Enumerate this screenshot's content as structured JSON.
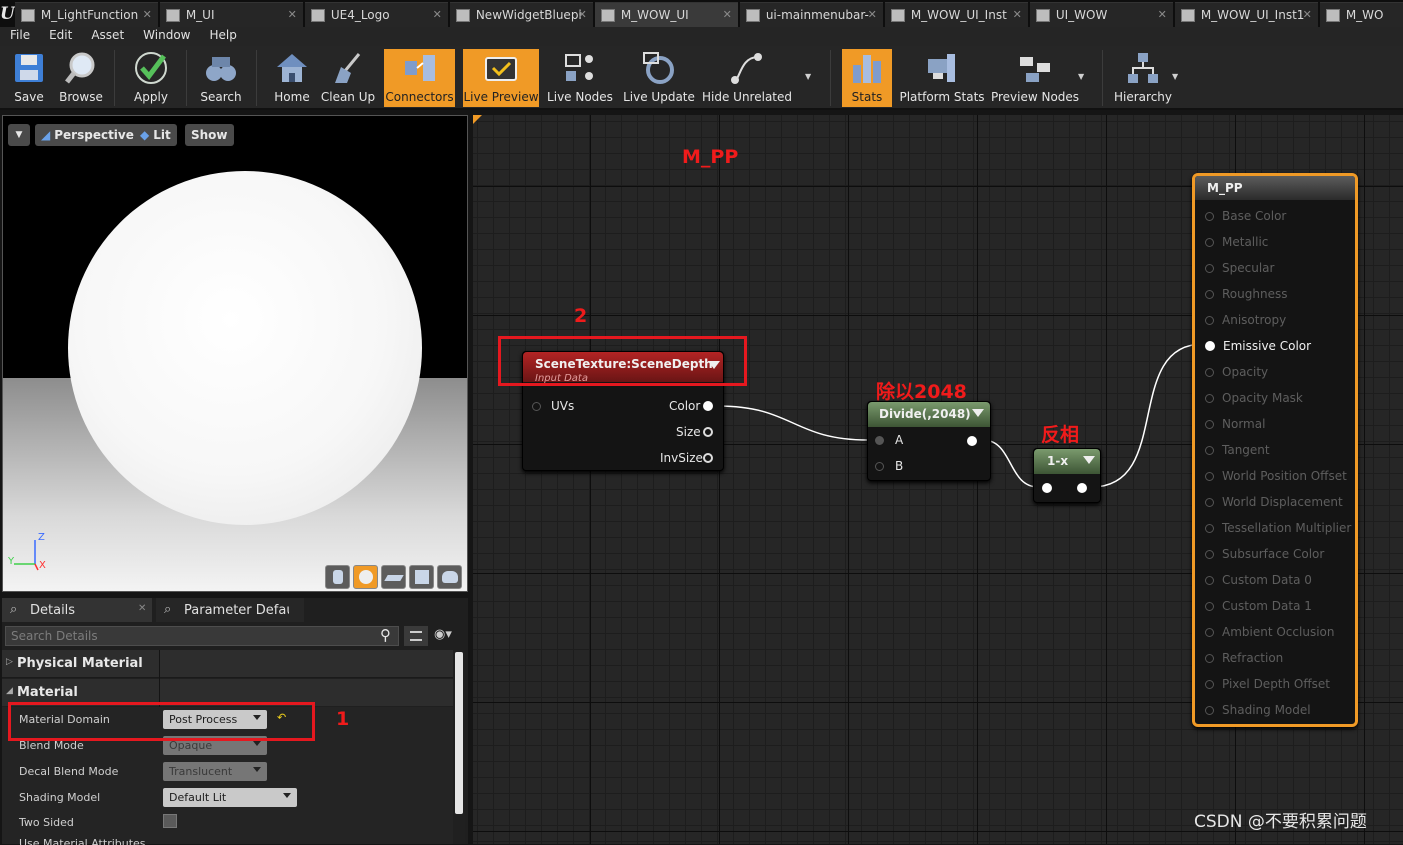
{
  "tabs": [
    "M_LightFunction",
    "M_UI",
    "UE4_Logo",
    "NewWidgetBluepi",
    "M_WOW_UI",
    "ui-mainmenubar-",
    "M_WOW_UI_Inst",
    "UI_WOW",
    "M_WOW_UI_Inst1",
    "M_WO"
  ],
  "menu": [
    "File",
    "Edit",
    "Asset",
    "Window",
    "Help"
  ],
  "toolbar": {
    "save": "Save",
    "browse": "Browse",
    "apply": "Apply",
    "search": "Search",
    "home": "Home",
    "cleanup": "Clean Up",
    "connectors": "Connectors",
    "livepreview": "Live Preview",
    "livenodes": "Live Nodes",
    "liveupdate": "Live Update",
    "hideunrelated": "Hide Unrelated",
    "stats": "Stats",
    "platformstats": "Platform Stats",
    "previewnodes": "Preview Nodes",
    "hierarchy": "Hierarchy"
  },
  "viewport": {
    "perspective": "Perspective",
    "lit": "Lit",
    "show": "Show",
    "axis_z": "Z",
    "axis_x": "X",
    "axis_y": "Y"
  },
  "details": {
    "tab1": "Details",
    "tab2": "Parameter Defaults",
    "search_placeholder": "Search Details",
    "cat_physical": "Physical Material",
    "cat_material": "Material",
    "rows": [
      {
        "label": "Material Domain",
        "value": "Post Process"
      },
      {
        "label": "Blend Mode",
        "value": "Opaque"
      },
      {
        "label": "Decal Blend Mode",
        "value": "Translucent"
      },
      {
        "label": "Shading Model",
        "value": "Default Lit"
      },
      {
        "label": "Two Sided",
        "value": ""
      },
      {
        "label": "Use Material Attributes",
        "value": ""
      }
    ]
  },
  "graph": {
    "title": "M_PP",
    "scene_node": {
      "title": "SceneTexture:SceneDepth",
      "subtitle": "Input Data",
      "in_uvs": "UVs",
      "out_color": "Color",
      "out_size": "Size",
      "out_invsize": "InvSize"
    },
    "divide_node": {
      "title": "Divide(,2048)",
      "in_a": "A",
      "in_b": "B"
    },
    "oneminus_node": {
      "title": "1-x"
    },
    "result_node": {
      "title": "M_PP",
      "inputs": [
        "Base Color",
        "Metallic",
        "Specular",
        "Roughness",
        "Anisotropy",
        "Emissive Color",
        "Opacity",
        "Opacity Mask",
        "Normal",
        "Tangent",
        "World Position Offset",
        "World Displacement",
        "Tessellation Multiplier",
        "Subsurface Color",
        "Custom Data 0",
        "Custom Data 1",
        "Ambient Occlusion",
        "Refraction",
        "Pixel Depth Offset",
        "Shading Model"
      ]
    },
    "annotations": {
      "a1": "1",
      "a2": "2",
      "a3": "除以2048",
      "a4": "反相"
    },
    "watermark": "CSDN @不要积累问题"
  },
  "colors": {
    "accent": "#f09a26",
    "annotation": "#e5181f"
  }
}
